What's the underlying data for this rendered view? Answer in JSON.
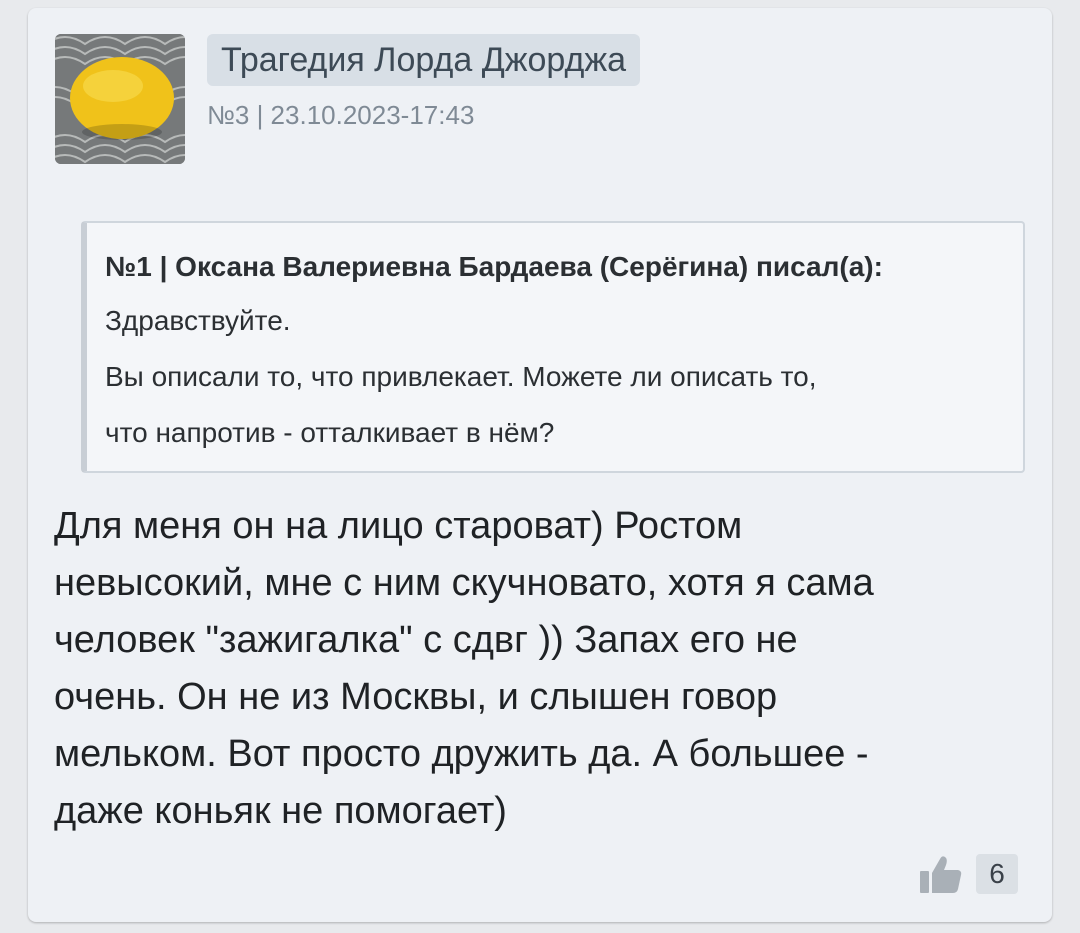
{
  "post": {
    "author": "Трагедия Лорда Джорджа",
    "meta": "№3 | 23.10.2023-17:43",
    "quote": {
      "header": "№1 | Оксана Валериевна Бардаева (Серёгина) писал(а):",
      "lines": [
        "Здравствуйте.",
        "Вы описали то, что привлекает. Можете ли описать то,",
        "что напротив - отталкивает в нём?"
      ]
    },
    "body_lines": [
      "Для меня он на лицо староват) Ростом",
      "невысокий, мне с ним скучновато, хотя я сама",
      "человек \"зажигалка\" с сдвг )) Запах его не",
      "очень. Он не из Москвы, и слышен говор",
      "мельком. Вот просто дружить да. А большее -",
      "даже коньяк не помогает)"
    ],
    "likes": "6"
  },
  "icons": {
    "avatar": "lemon-avatar-image",
    "like": "thumbs-up-icon"
  },
  "colors": {
    "card_bg": "#eef1f5",
    "name_badge_bg": "#d8dfe6",
    "quote_border": "#c8ced5",
    "like_icon": "#a9b0b7"
  }
}
